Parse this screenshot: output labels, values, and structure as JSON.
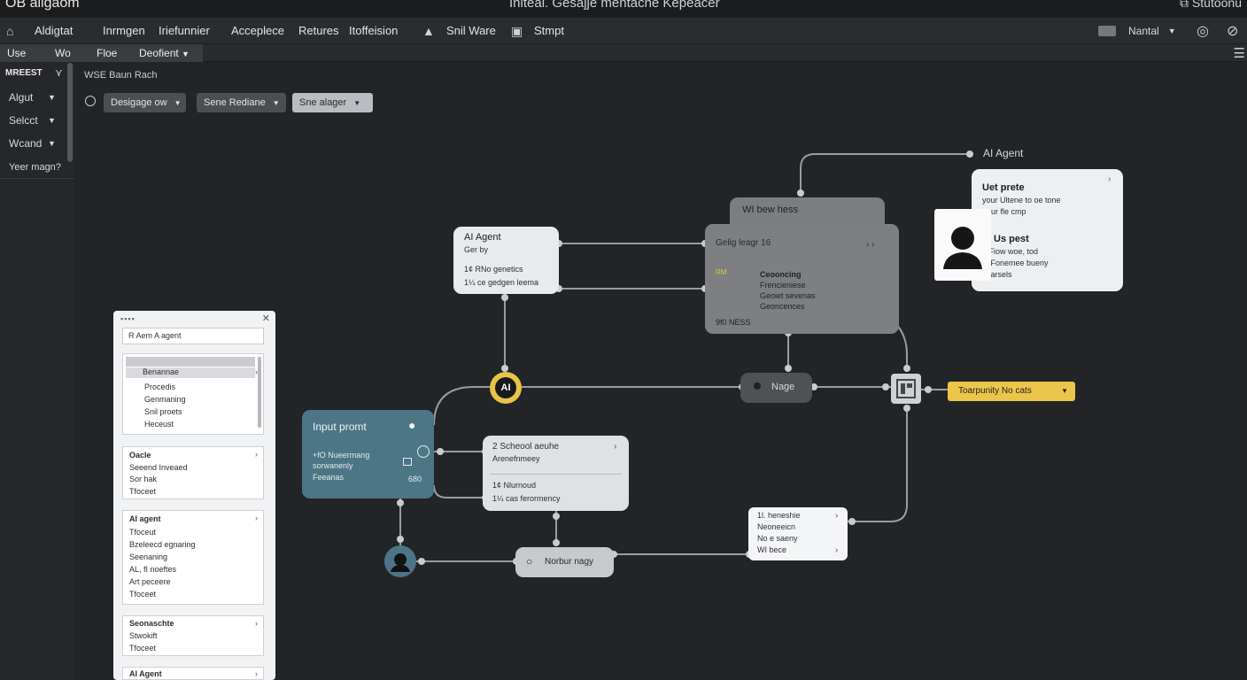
{
  "window": {
    "app_title": "OB allgaom",
    "title": "Initeal. Gesajje mentache Kepeacer",
    "right_label": "Stutoonu"
  },
  "menubar": {
    "items": [
      "Aldigtat",
      "Inrmgen",
      "Iriefunnier",
      "Acceplece",
      "Retures",
      "Itoffeision",
      "Snil Ware",
      "Stmpt"
    ],
    "mode_label": "Nantal"
  },
  "submenu": {
    "items": [
      "Use",
      "Wo",
      "Floe",
      "Deofient"
    ]
  },
  "sidebar": {
    "header": "MREEST",
    "selects": [
      "Algut",
      "Selcct",
      "Wcand"
    ],
    "question": "Yeer magn?"
  },
  "canvas": {
    "title": "WSE Baun Rach",
    "dropdowns": [
      "Desigage ow",
      "Sene Rediane",
      "Sne alager"
    ]
  },
  "nodes": {
    "ai_agent_card": {
      "title": "AI Agent",
      "sub": "Ger by",
      "line1": "1¢ RNo genetics",
      "line2": "1¼ ce gedgen leema"
    },
    "wi_header": {
      "title": "WI bew hess"
    },
    "wi_card": {
      "sub": "Gelig leagr 16",
      "flag": "RM",
      "l1": "Ceooncing",
      "l2": "Frencieniese",
      "l3": "Geoiet sevenas",
      "l4": "Geoncences",
      "footer": "9f0 NESS"
    },
    "ai_agent_label": "AI Agent",
    "user_prompt": {
      "title": "Uet prete",
      "l1": "your Ultene to oe tone",
      "l2": "pour fle cmp",
      "title2": "Us pest",
      "l3": "b Fiow woe, tod",
      "l4": "bi Fonemee bueny",
      "l5": "ecarsels"
    },
    "ai_chip": "AI",
    "nage_pill": "Nage",
    "temp_chip": "Toarpunity No cats",
    "input_prompt": {
      "title": "Input promt",
      "l1": "+fO Nueermang",
      "l2": "sorwanenly",
      "l3": "Feeanas",
      "num": "680"
    },
    "school_card": {
      "title": "2 Scheool aeuhe",
      "sub": "Arenefnmeey",
      "l1": "1¢ Nlurnoud",
      "l2": "1¼ cas ferormency"
    },
    "menu_card": {
      "l1": "1l. heneshie",
      "l2": "Neoneeicn",
      "l3": "No e saeny",
      "l4": "WI bece"
    },
    "search_pill": "Norbur nagy"
  },
  "panel": {
    "search_text": "R Aem A agent",
    "list": {
      "header": "Benannae",
      "items": [
        "Procedis",
        "Genmaning",
        "Snil proets",
        "Heceust"
      ]
    },
    "group1": {
      "title": "Oacle",
      "items": [
        "Seeend Inveaed",
        "Sor hak",
        "Tfoceet"
      ]
    },
    "group2": {
      "title": "AI agent",
      "items": [
        "Tfoceut",
        "Bzeleecd egnaring",
        "Seenaning",
        "AL, fI noeftes",
        "Art peceere",
        "Tfoceet"
      ]
    },
    "group3": {
      "title": "Seonaschte",
      "items": [
        "Stwokift",
        "Tfoceet"
      ]
    },
    "group4": {
      "title": "AI Agent"
    }
  }
}
